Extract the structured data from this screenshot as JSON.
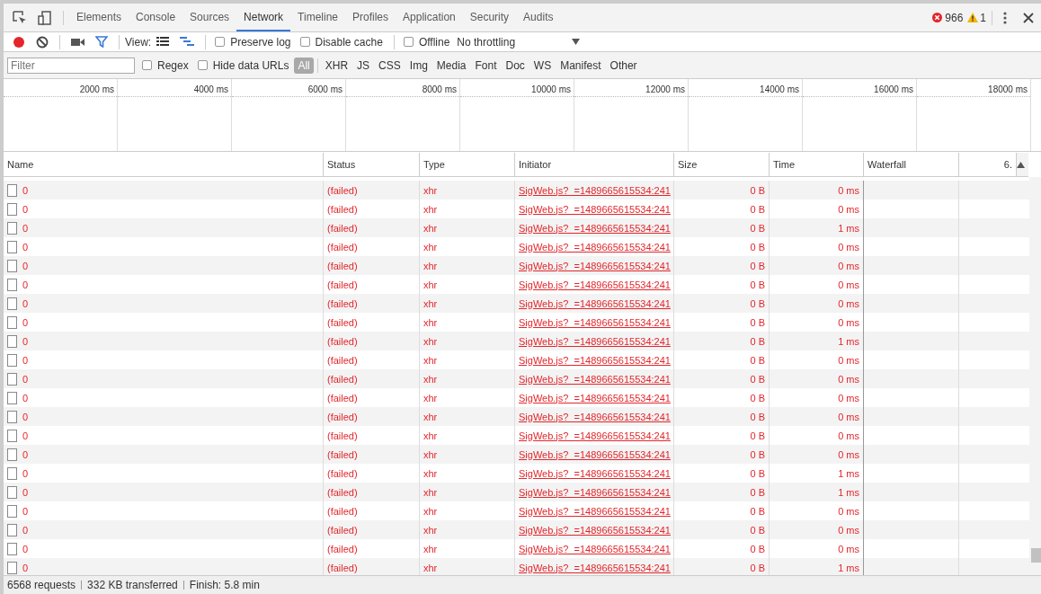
{
  "tabs": [
    {
      "label": "Elements",
      "selected": false
    },
    {
      "label": "Console",
      "selected": false
    },
    {
      "label": "Sources",
      "selected": false
    },
    {
      "label": "Network",
      "selected": true
    },
    {
      "label": "Timeline",
      "selected": false
    },
    {
      "label": "Profiles",
      "selected": false
    },
    {
      "label": "Application",
      "selected": false
    },
    {
      "label": "Security",
      "selected": false
    },
    {
      "label": "Audits",
      "selected": false
    }
  ],
  "counters": {
    "errors": "966",
    "warnings": "1"
  },
  "toolbar": {
    "recording": true,
    "filter_on": true,
    "view_label": "View:",
    "large_rows": false,
    "overview": true,
    "options": [
      {
        "label": "Preserve log",
        "checked": false
      },
      {
        "label": "Disable cache",
        "checked": false
      }
    ],
    "offline": {
      "label": "Offline",
      "checked": false
    },
    "throttling": "No throttling"
  },
  "filter_bar": {
    "placeholder": "Filter",
    "options": [
      {
        "label": "Regex",
        "checked": false
      },
      {
        "label": "Hide data URLs",
        "checked": false
      }
    ],
    "types": [
      {
        "label": "All",
        "selected": true
      },
      {
        "label": "XHR",
        "selected": false
      },
      {
        "label": "JS",
        "selected": false
      },
      {
        "label": "CSS",
        "selected": false
      },
      {
        "label": "Img",
        "selected": false
      },
      {
        "label": "Media",
        "selected": false
      },
      {
        "label": "Font",
        "selected": false
      },
      {
        "label": "Doc",
        "selected": false
      },
      {
        "label": "WS",
        "selected": false
      },
      {
        "label": "Manifest",
        "selected": false
      },
      {
        "label": "Other",
        "selected": false
      }
    ]
  },
  "overview_ticks": [
    "2000 ms",
    "4000 ms",
    "6000 ms",
    "8000 ms",
    "10000 ms",
    "12000 ms",
    "14000 ms",
    "16000 ms",
    "18000 ms"
  ],
  "table": {
    "columns": [
      "Name",
      "Status",
      "Type",
      "Initiator",
      "Size",
      "Time",
      "Waterfall",
      "6."
    ],
    "rows": [
      {
        "name": "0",
        "status": "(failed)",
        "type": "xhr",
        "initiator": "SigWeb.js?_=1489665615534:241",
        "size": "0 B",
        "time": "0 ms"
      },
      {
        "name": "0",
        "status": "(failed)",
        "type": "xhr",
        "initiator": "SigWeb.js?_=1489665615534:241",
        "size": "0 B",
        "time": "0 ms"
      },
      {
        "name": "0",
        "status": "(failed)",
        "type": "xhr",
        "initiator": "SigWeb.js?_=1489665615534:241",
        "size": "0 B",
        "time": "1 ms"
      },
      {
        "name": "0",
        "status": "(failed)",
        "type": "xhr",
        "initiator": "SigWeb.js?_=1489665615534:241",
        "size": "0 B",
        "time": "0 ms"
      },
      {
        "name": "0",
        "status": "(failed)",
        "type": "xhr",
        "initiator": "SigWeb.js?_=1489665615534:241",
        "size": "0 B",
        "time": "0 ms"
      },
      {
        "name": "0",
        "status": "(failed)",
        "type": "xhr",
        "initiator": "SigWeb.js?_=1489665615534:241",
        "size": "0 B",
        "time": "0 ms"
      },
      {
        "name": "0",
        "status": "(failed)",
        "type": "xhr",
        "initiator": "SigWeb.js?_=1489665615534:241",
        "size": "0 B",
        "time": "0 ms"
      },
      {
        "name": "0",
        "status": "(failed)",
        "type": "xhr",
        "initiator": "SigWeb.js?_=1489665615534:241",
        "size": "0 B",
        "time": "0 ms"
      },
      {
        "name": "0",
        "status": "(failed)",
        "type": "xhr",
        "initiator": "SigWeb.js?_=1489665615534:241",
        "size": "0 B",
        "time": "1 ms"
      },
      {
        "name": "0",
        "status": "(failed)",
        "type": "xhr",
        "initiator": "SigWeb.js?_=1489665615534:241",
        "size": "0 B",
        "time": "0 ms"
      },
      {
        "name": "0",
        "status": "(failed)",
        "type": "xhr",
        "initiator": "SigWeb.js?_=1489665615534:241",
        "size": "0 B",
        "time": "0 ms"
      },
      {
        "name": "0",
        "status": "(failed)",
        "type": "xhr",
        "initiator": "SigWeb.js?_=1489665615534:241",
        "size": "0 B",
        "time": "0 ms"
      },
      {
        "name": "0",
        "status": "(failed)",
        "type": "xhr",
        "initiator": "SigWeb.js?_=1489665615534:241",
        "size": "0 B",
        "time": "0 ms"
      },
      {
        "name": "0",
        "status": "(failed)",
        "type": "xhr",
        "initiator": "SigWeb.js?_=1489665615534:241",
        "size": "0 B",
        "time": "0 ms"
      },
      {
        "name": "0",
        "status": "(failed)",
        "type": "xhr",
        "initiator": "SigWeb.js?_=1489665615534:241",
        "size": "0 B",
        "time": "0 ms"
      },
      {
        "name": "0",
        "status": "(failed)",
        "type": "xhr",
        "initiator": "SigWeb.js?_=1489665615534:241",
        "size": "0 B",
        "time": "1 ms"
      },
      {
        "name": "0",
        "status": "(failed)",
        "type": "xhr",
        "initiator": "SigWeb.js?_=1489665615534:241",
        "size": "0 B",
        "time": "1 ms"
      },
      {
        "name": "0",
        "status": "(failed)",
        "type": "xhr",
        "initiator": "SigWeb.js?_=1489665615534:241",
        "size": "0 B",
        "time": "0 ms"
      },
      {
        "name": "0",
        "status": "(failed)",
        "type": "xhr",
        "initiator": "SigWeb.js?_=1489665615534:241",
        "size": "0 B",
        "time": "0 ms"
      },
      {
        "name": "0",
        "status": "(failed)",
        "type": "xhr",
        "initiator": "SigWeb.js?_=1489665615534:241",
        "size": "0 B",
        "time": "0 ms"
      },
      {
        "name": "0",
        "status": "(failed)",
        "type": "xhr",
        "initiator": "SigWeb.js?_=1489665615534:241",
        "size": "0 B",
        "time": "1 ms"
      }
    ]
  },
  "status_bar": [
    "6568 requests",
    "332 KB transferred",
    "Finish: 5.8 min"
  ]
}
